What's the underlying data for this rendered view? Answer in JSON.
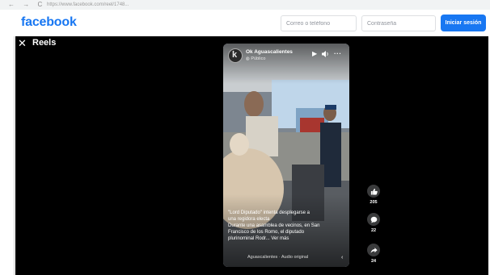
{
  "browser": {
    "nav": "← →  C",
    "url": "https://www.facebook.com/reel/1748..."
  },
  "header": {
    "logo": "facebook",
    "email_placeholder": "Correo o teléfono",
    "password_placeholder": "Contraseña",
    "login_label": "Iniciar sesión",
    "brand_color": "#1877f2"
  },
  "reels": {
    "close_glyph": "✕",
    "title": "Reels"
  },
  "video": {
    "page_name": "Ok Aguascalientes",
    "avatar_letter": "k",
    "audience": "Público",
    "controls": {
      "play": "play-icon",
      "volume": "volume-icon",
      "more": "more-icon"
    },
    "caption_lines": [
      "\"Lord Diputado\" intenta desplegarse a",
      "una regidora electa",
      "Durante una asamblea de vecinos, en San",
      "Francisco de los Romo, el diputado",
      "plurinominal Rodr... Ver más"
    ],
    "audio": "Aguascalientes · Audio original",
    "audio_chevron": "‹"
  },
  "actions": {
    "like_count": "205",
    "comment_count": "22",
    "share_count": "24"
  }
}
